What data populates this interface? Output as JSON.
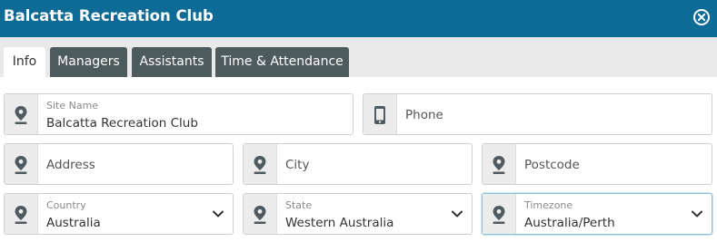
{
  "dialog": {
    "title": "Balcatta Recreation Club",
    "close_icon": "close-circle-icon"
  },
  "tabs": [
    {
      "label": "Info",
      "active": true
    },
    {
      "label": "Managers",
      "active": false
    },
    {
      "label": "Assistants",
      "active": false
    },
    {
      "label": "Time & Attendance",
      "active": false
    }
  ],
  "form": {
    "site_name": {
      "label": "Site Name",
      "value": "Balcatta Recreation Club",
      "icon": "location-pin-icon"
    },
    "phone": {
      "placeholder": "Phone",
      "icon": "phone-icon"
    },
    "address": {
      "placeholder": "Address",
      "icon": "location-pin-icon"
    },
    "city": {
      "placeholder": "City",
      "icon": "location-pin-icon"
    },
    "postcode": {
      "placeholder": "Postcode",
      "icon": "location-pin-icon"
    },
    "country": {
      "label": "Country",
      "value": "Australia",
      "icon": "location-pin-icon"
    },
    "state": {
      "label": "State",
      "value": "Western Australia",
      "icon": "location-pin-icon"
    },
    "timezone": {
      "label": "Timezone",
      "value": "Australia/Perth",
      "icon": "location-pin-icon"
    }
  },
  "colors": {
    "header_bg": "#0e6b95",
    "tab_bg": "#4d5a5e",
    "tab_active_bg": "#ffffff",
    "focus_border": "#8fc1dc"
  }
}
